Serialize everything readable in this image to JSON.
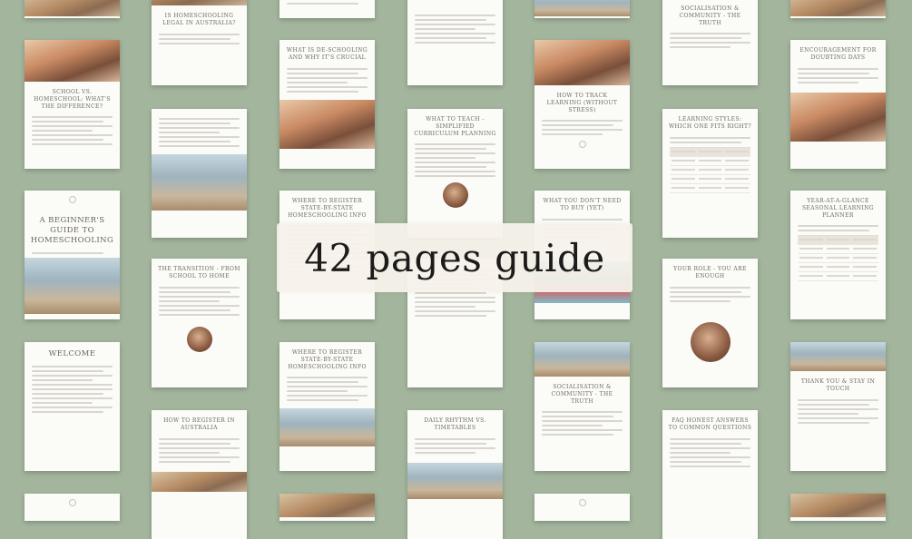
{
  "banner": {
    "text": "42 pages guide"
  },
  "pages": {
    "homeschooling_legal": "Is homeschooling legal in Australia?",
    "school_vs_homeschool": "School vs. Homeschool: what's the difference?",
    "beginners_guide": "A beginner's guide to homeschooling",
    "welcome": "Welcome",
    "what_is_deschooling": "What is de-schooling and why it's crucial",
    "transition": "The transition - from school to home",
    "how_to_register": "How to register in Australia",
    "what_to_teach": "What to teach - simplified curriculum planning",
    "where_to_register": "Where to register state-by-state homeschooling info",
    "where_to_register_2": "Where to register state-by-state homeschooling info",
    "daily_rhythm": "Daily rhythm vs. timetables",
    "track_learning": "How to track learning (without stress)",
    "dont_need": "What you don't need to buy (yet)",
    "socialisation": "Socialisation & community - the truth",
    "socialisation_2": "Socialisation & community - the truth",
    "learning_styles": "Learning styles: which one fits right?",
    "your_role": "Your role - you are enough",
    "faq": "FAQ honest answers to common questions",
    "encouragement": "Encouragement for doubting days",
    "year_at_a_glance": "Year-at-a-glance seasonal learning planner",
    "thank_you": "Thank you & stay in touch"
  }
}
